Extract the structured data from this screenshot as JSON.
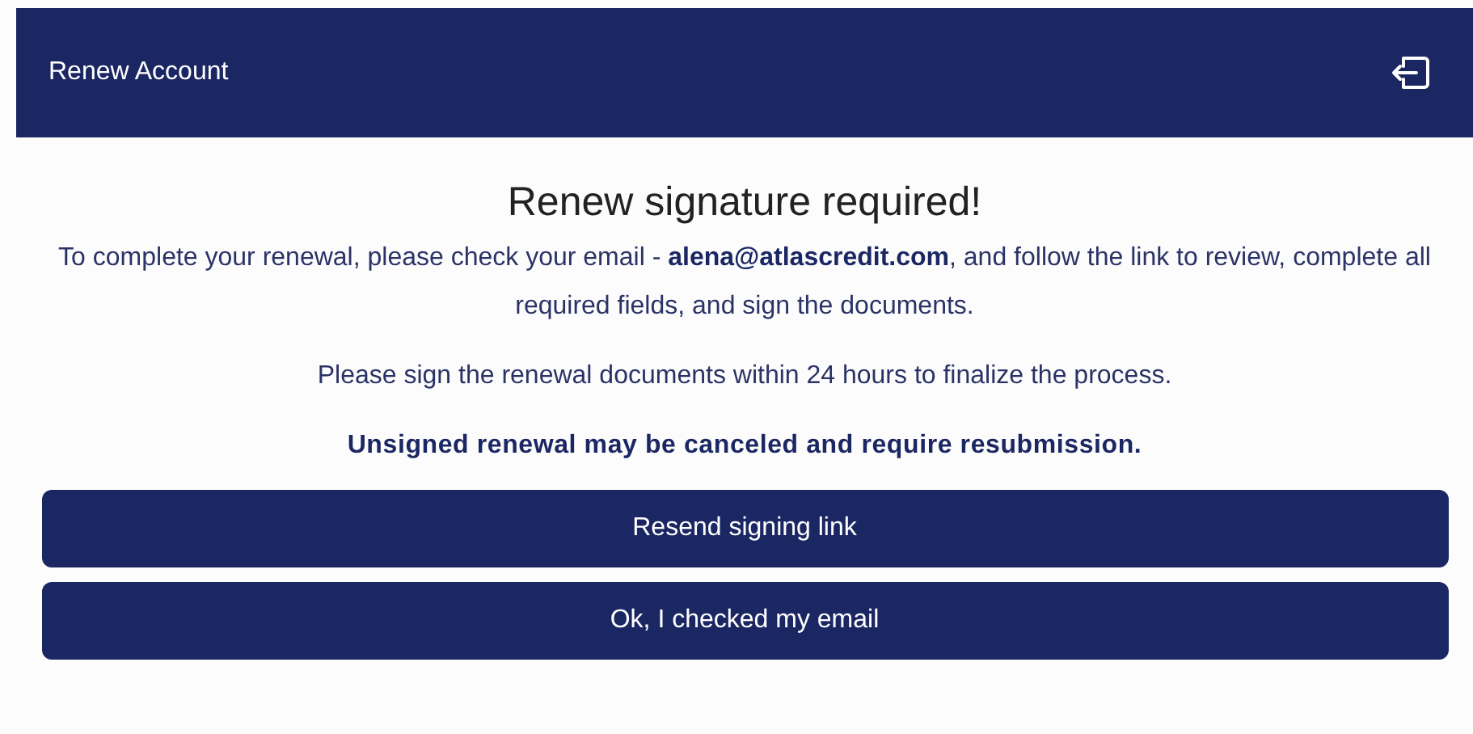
{
  "header": {
    "title": "Renew Account"
  },
  "heading": "Renew signature required!",
  "paragraphs": [
    "To complete your renewal, please check your email - **alena@atlascredit.com**, and follow the link to review, complete all required fields, and sign the documents.",
    "Please sign the renewal documents within 24 hours to finalize the process."
  ],
  "warning": "Unsigned renewal may be canceled and require resubmission.",
  "buttons": [
    "Resend signing link",
    "Ok, I checked my email"
  ]
}
